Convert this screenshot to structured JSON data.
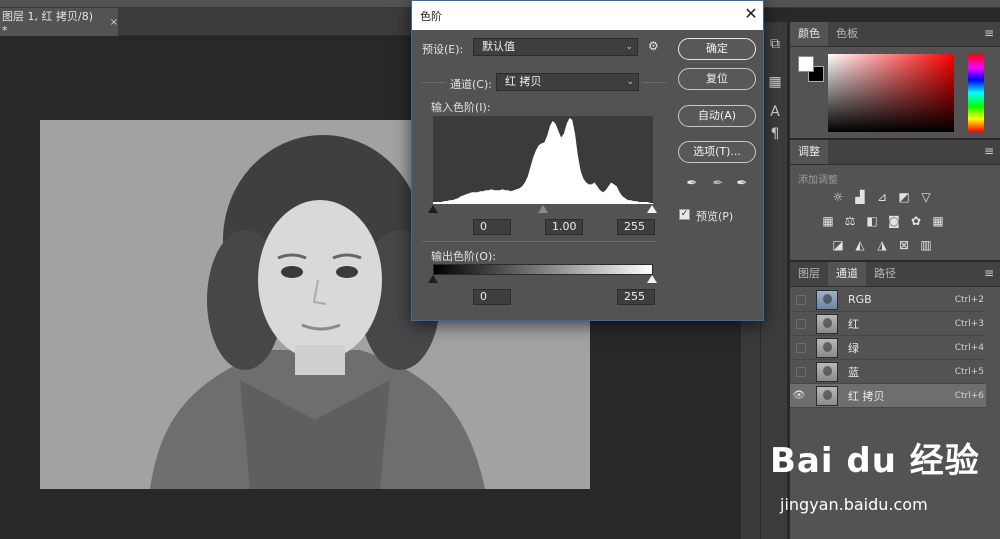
{
  "document": {
    "tab_title": "图层 1, 红 拷贝/8) *",
    "tab_close": "×"
  },
  "dialog": {
    "title": "色阶",
    "close": "✕",
    "preset_label": "预设(E):",
    "preset_value": "默认值",
    "channel_label": "通道(C):",
    "channel_value": "红 拷贝",
    "input_levels_label": "输入色阶(I):",
    "input_shadow": "0",
    "input_midtone": "1.00",
    "input_highlight": "255",
    "output_levels_label": "输出色阶(O):",
    "output_shadow": "0",
    "output_highlight": "255",
    "buttons": {
      "ok": "确定",
      "reset": "复位",
      "auto": "自动(A)",
      "options": "选项(T)..."
    },
    "preview_label": "预览(P)",
    "preview_checked": true,
    "histogram": [
      2,
      2,
      2,
      2,
      3,
      3,
      4,
      4,
      5,
      6,
      8,
      9,
      10,
      11,
      12,
      12,
      12,
      13,
      13,
      14,
      14,
      15,
      14,
      14,
      14,
      15,
      14,
      14,
      13,
      14,
      15,
      16,
      18,
      22,
      28,
      38,
      48,
      55,
      60,
      62,
      63,
      70,
      80,
      85,
      82,
      75,
      68,
      72,
      82,
      88,
      86,
      72,
      50,
      34,
      26,
      22,
      20,
      20,
      22,
      18,
      14,
      12,
      14,
      18,
      22,
      20,
      18,
      12,
      8,
      6,
      4,
      4,
      3,
      3,
      2,
      2,
      2,
      2,
      1,
      1
    ]
  },
  "panels": {
    "color": {
      "tabs": [
        "颜色",
        "色板"
      ],
      "foreground": "#ffffff",
      "background": "#000000"
    },
    "adjustments": {
      "tab": "调整",
      "hint": "添加调整"
    },
    "channels": {
      "tabs": [
        "图层",
        "通道",
        "路径"
      ],
      "rows": [
        {
          "name": "RGB",
          "shortcut": "Ctrl+2",
          "visible": false,
          "selected": false
        },
        {
          "name": "红",
          "shortcut": "Ctrl+3",
          "visible": false,
          "selected": false
        },
        {
          "name": "绿",
          "shortcut": "Ctrl+4",
          "visible": false,
          "selected": false
        },
        {
          "name": "蓝",
          "shortcut": "Ctrl+5",
          "visible": false,
          "selected": false
        },
        {
          "name": "红 拷贝",
          "shortcut": "Ctrl+6",
          "visible": true,
          "selected": true
        }
      ]
    }
  },
  "watermark": {
    "logo": "Bai du 经验",
    "url": "jingyan.baidu.com"
  }
}
